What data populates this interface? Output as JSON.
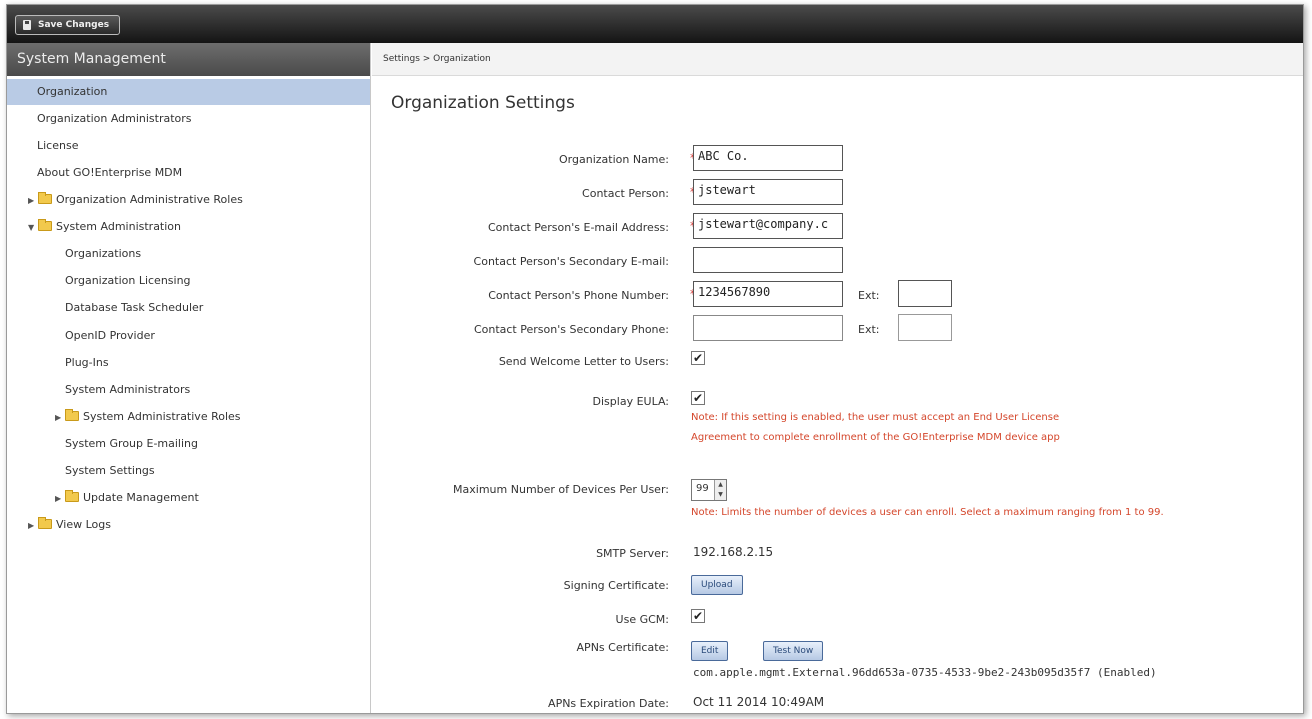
{
  "toolbar": {
    "save_label": "Save Changes"
  },
  "sidebar": {
    "title": "System Management",
    "items": [
      {
        "label": "Organization"
      },
      {
        "label": "Organization Administrators"
      },
      {
        "label": "License"
      },
      {
        "label": "About GO!Enterprise MDM"
      },
      {
        "label": "Organization Administrative Roles"
      },
      {
        "label": "System Administration"
      },
      {
        "label": "Organizations"
      },
      {
        "label": "Organization Licensing"
      },
      {
        "label": "Database Task Scheduler"
      },
      {
        "label": "OpenID Provider"
      },
      {
        "label": "Plug-Ins"
      },
      {
        "label": "System Administrators"
      },
      {
        "label": "System Administrative Roles"
      },
      {
        "label": "System Group E-mailing"
      },
      {
        "label": "System Settings"
      },
      {
        "label": "Update Management"
      },
      {
        "label": "View Logs"
      }
    ]
  },
  "breadcrumb": "Settings > Organization",
  "page_title": "Organization Settings",
  "form": {
    "org_name": {
      "label": "Organization Name:",
      "value": "ABC Co."
    },
    "contact_person": {
      "label": "Contact Person:",
      "value": "jstewart"
    },
    "email": {
      "label": "Contact Person's E-mail Address:",
      "value": "jstewart@company.c"
    },
    "secondary_email": {
      "label": "Contact Person's Secondary E-mail:",
      "value": ""
    },
    "phone": {
      "label": "Contact Person's Phone Number:",
      "value": "1234567890",
      "ext_label": "Ext:",
      "ext_value": ""
    },
    "secondary_phone": {
      "label": "Contact Person's Secondary Phone:",
      "value": "",
      "ext_label": "Ext:",
      "ext_value": ""
    },
    "welcome_letter": {
      "label": "Send Welcome Letter to Users:",
      "checked": true
    },
    "eula": {
      "label": "Display EULA:",
      "checked": true,
      "note_line1": "Note: If this setting is enabled, the user must accept an End User License",
      "note_line2": "Agreement to complete enrollment of the GO!Enterprise MDM device app"
    },
    "max_devices": {
      "label": "Maximum Number of Devices Per User:",
      "value": "99",
      "note": "Note: Limits the number of devices a user can enroll. Select a maximum ranging from 1 to 99."
    },
    "smtp": {
      "label": "SMTP Server:",
      "value": "192.168.2.15"
    },
    "signing_cert": {
      "label": "Signing Certificate:",
      "button": "Upload"
    },
    "gcm": {
      "label": "Use GCM:",
      "checked": true
    },
    "apns_cert": {
      "label": "APNs Certificate:",
      "edit_button": "Edit",
      "test_button": "Test Now",
      "value": "com.apple.mgmt.External.96dd653a-0735-4533-9be2-243b095d35f7 (Enabled)"
    },
    "apns_expiration": {
      "label": "APNs Expiration Date:",
      "value": "Oct 11 2014 10:49AM"
    }
  },
  "colors": {
    "toolbar_bg": "#1e1e1e",
    "sidebar_header": "#5a5a5a",
    "active_item": "#b9cbe5",
    "required": "#d0312d",
    "note": "#d4462b"
  }
}
